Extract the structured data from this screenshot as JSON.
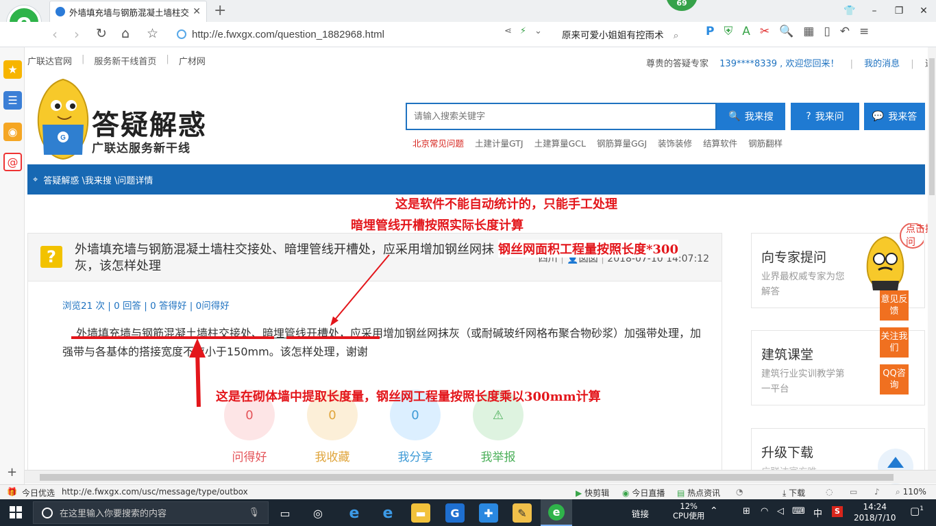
{
  "browser": {
    "tab_title": "外墙填充墙与钢筋混凝土墙柱交接处",
    "badge_count": "69",
    "url": "http://e.fwxgx.com/question_1882968.html",
    "search_hint": "原来可爱小姐姐有控雨术",
    "zoom": "110%"
  },
  "topnav": {
    "links": [
      "广联达官网",
      "服务新干线首页",
      "广材网"
    ],
    "expert": "尊贵的答疑专家",
    "user": "139****8339 , 欢迎您回来！",
    "messages": "我的消息",
    "logout": "退"
  },
  "header": {
    "title": "答疑解惑",
    "subtitle": "广联达服务新干线",
    "search_placeholder": "请输入搜索关键字",
    "btn_search": "我来搜",
    "btn_ask": "我来问",
    "btn_answer": "我来答",
    "hot_links": [
      "北京常见问题",
      "土建计量GTJ",
      "土建算量GCL",
      "钢筋算量GGJ",
      "装饰装修",
      "结算软件",
      "钢筋翻样"
    ]
  },
  "breadcrumb": "答疑解惑 \\我来搜 \\问题详情",
  "question": {
    "title": "外墙填充墙与钢筋混凝土墙柱交接处、暗埋管线开槽处，应采用增加钢丝网抹灰，该怎样处理",
    "region": "四川",
    "author": "囡囡",
    "date": "2018-07-10 14:07:12",
    "stats": "浏览21 次 | 0 回答 | 0 答得好 | 0问得好",
    "body_part1": "外墙填充墙与钢筋混凝土墙柱交接处",
    "body_sep": "、",
    "body_part2": "暗埋管线开槽处",
    "body_rest": "，应采用增加钢丝网抹灰（或耐碱玻纤网格布聚合物砂浆）加强带处理，加强带与各基体的搭接宽度不应小于150mm。该怎样处理，谢谢",
    "actions": [
      {
        "label": "问得好",
        "count": "0",
        "color": "#e4555a",
        "bg": "#fde5e6"
      },
      {
        "label": "我收藏",
        "count": "0",
        "color": "#e0a53c",
        "bg": "#fcefd8"
      },
      {
        "label": "我分享",
        "count": "0",
        "color": "#3e9ad6",
        "bg": "#dcefff"
      },
      {
        "label": "我举报",
        "count": "",
        "color": "#4cb05a",
        "bg": "#def3e0"
      }
    ]
  },
  "right_panels": {
    "p1_title": "向专家提问",
    "p1_sub": "业界最权威专家为您解答",
    "p2_title": "建筑课堂",
    "p2_sub": "建筑行业实训教学第一平台",
    "p3_title": "升级下载",
    "p3_sub": "广联达官方唯一",
    "float_tag": "点击提问",
    "feedback": "意见反馈",
    "follow": "关注我们",
    "qq": "QQ咨询"
  },
  "annotations": {
    "a1": "这是软件不能自动统计的，只能手工处理",
    "a2": "暗埋管线开槽按照实际长度计算",
    "a3": "钢丝网面积工程量按照长度*300",
    "a4": "这是在砌体墙中提取长度量，钢丝网工程量按照长度乘以300mm计算"
  },
  "statusbar": {
    "left": "今日优选",
    "url": "http://e.fwxgx.com/usc/message/type/outbox",
    "items": [
      "快剪辑",
      "今日直播",
      "热点资讯",
      "下载"
    ],
    "zoom": "110%"
  },
  "taskbar": {
    "search_placeholder": "在这里输入你要搜索的内容",
    "link": "链接",
    "cpu_percent": "12%",
    "cpu_label": "CPU使用",
    "ime": "中",
    "time": "14:24",
    "date": "2018/7/10",
    "notification_count": "1"
  }
}
